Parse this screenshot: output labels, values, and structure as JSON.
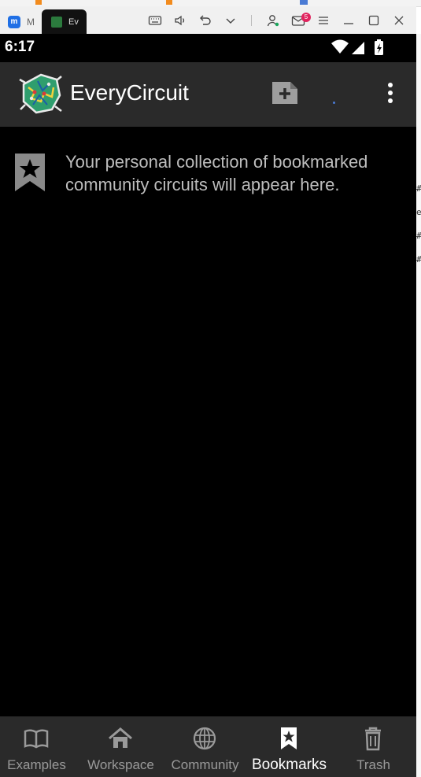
{
  "host_window": {
    "app_tab_label": "M",
    "emulator_tab_label": "Ev",
    "mail_badge_count": "5"
  },
  "status_bar": {
    "time": "6:17"
  },
  "app_bar": {
    "title": "EveryCircuit"
  },
  "content": {
    "empty_message": "Your personal collection of bookmarked community circuits will appear here."
  },
  "bottom_nav": {
    "items": [
      {
        "label": "Examples",
        "icon": "book-icon"
      },
      {
        "label": "Workspace",
        "icon": "home-icon"
      },
      {
        "label": "Community",
        "icon": "globe-icon"
      },
      {
        "label": "Bookmarks",
        "icon": "bookmark-star-icon",
        "active": true
      },
      {
        "label": "Trash",
        "icon": "trash-icon"
      }
    ]
  },
  "colors": {
    "app_bar_bg": "#2a2a2a",
    "content_bg": "#000000",
    "active_label": "#ffffff",
    "inactive_label": "#9a9a9a"
  }
}
